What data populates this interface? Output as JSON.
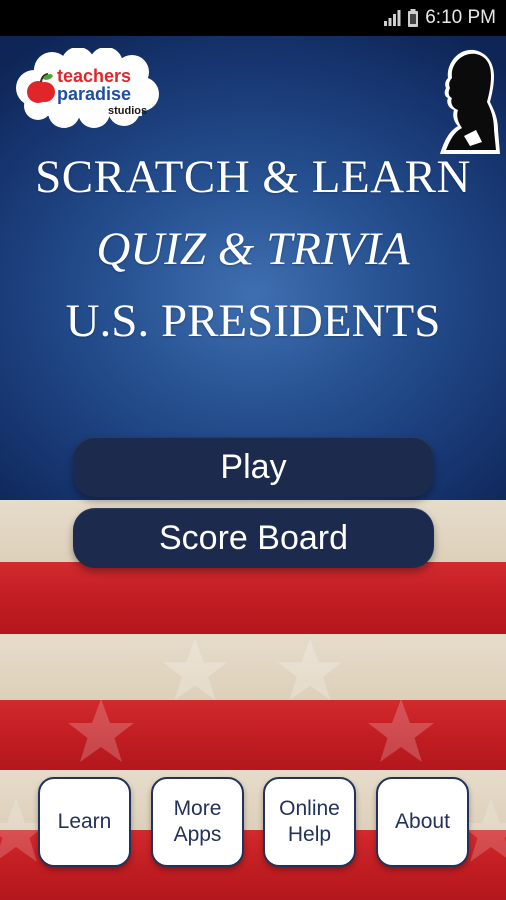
{
  "status_bar": {
    "time": "6:10 PM",
    "icons": [
      "signal-icon",
      "battery-icon"
    ]
  },
  "logo": {
    "line1": "teachers",
    "line2": "paradise",
    "line3": "studios",
    "icon": "apple-icon"
  },
  "header": {
    "silhouette": "lincoln-silhouette-icon",
    "title_line1": "SCRATCH & LEARN",
    "title_line2": "QUIZ & TRIVIA",
    "title_line3": "U.S. PRESIDENTS"
  },
  "menu": {
    "play_label": "Play",
    "scoreboard_label": "Score Board"
  },
  "tiles": {
    "learn": "Learn",
    "more_apps": "More\nApps",
    "online_help": "Online\nHelp",
    "about": "About"
  },
  "colors": {
    "navy": "#1c2a4d",
    "flag_blue": "#254f8f",
    "flag_red": "#c01d22",
    "flag_cream": "#e2d6c2",
    "logo_red": "#e0262b",
    "logo_blue": "#1f4fa3"
  }
}
